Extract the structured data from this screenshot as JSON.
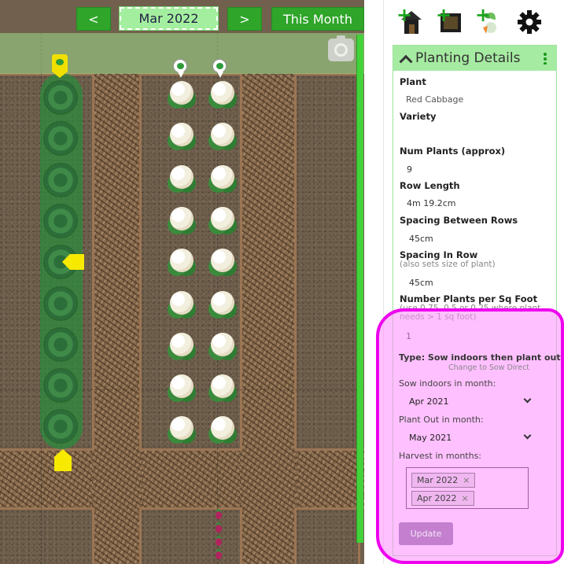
{
  "nav": {
    "prev": "<",
    "month": "Mar 2022",
    "next": ">",
    "this_month": "This Month"
  },
  "toolbar": {
    "icons": [
      "add-structure-icon",
      "add-bed-icon",
      "add-plant-icon",
      "settings-icon"
    ]
  },
  "card": {
    "title": "Planting Details",
    "fields": {
      "plant_label": "Plant",
      "plant_value": "Red Cabbage",
      "variety_label": "Variety",
      "variety_value": "",
      "num_plants_label": "Num Plants (approx)",
      "num_plants_value": "9",
      "row_length_label": "Row Length",
      "row_length_value": "4m 19.2cm",
      "spacing_rows_label": "Spacing Between Rows",
      "spacing_rows_value": "45cm",
      "spacing_row_label": "Spacing In Row",
      "spacing_row_hint": "(also sets size of plant)",
      "spacing_row_value": "45cm",
      "per_sqft_label": "Number Plants per Sq Foot",
      "per_sqft_hint": "(use 0.75, 0.5 or 0.25 where plant needs > 1 sq foot)",
      "per_sqft_value": "1"
    },
    "type_label": "Type: Sow indoors then plant out",
    "change_link": "Change to Sow Direct",
    "sow_label": "Sow indoors in month:",
    "sow_value": "Apr 2021",
    "plantout_label": "Plant Out in month:",
    "plantout_value": "May 2021",
    "harvest_label": "Harvest in months:",
    "harvest": [
      "Mar 2022",
      "Apr 2022"
    ],
    "remove_symbol": "×",
    "update_button": "Update"
  },
  "colors": {
    "nav_green": "#2fa52a",
    "header_green": "#a6eba2",
    "highlight": "#ee00ee"
  }
}
